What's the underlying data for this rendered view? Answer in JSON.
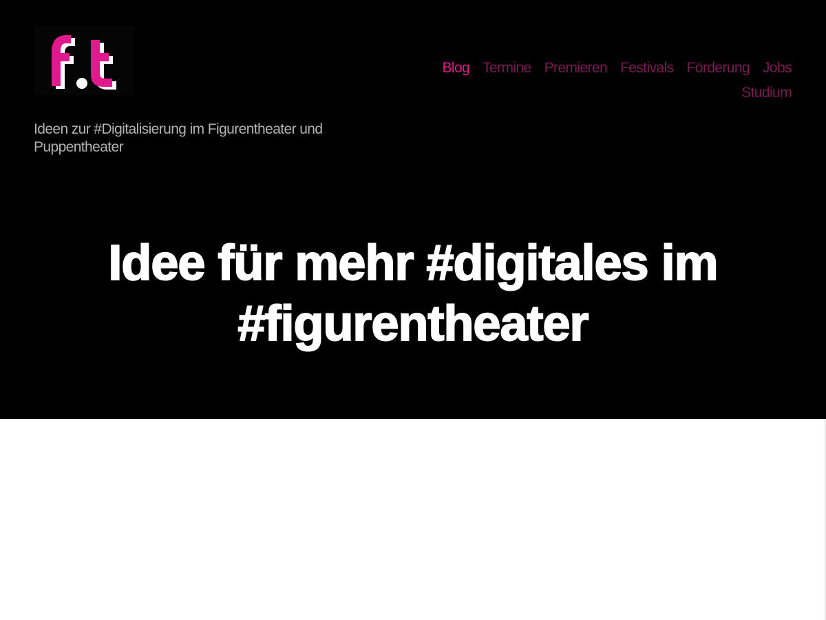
{
  "site": {
    "logo_text": "f.t",
    "tagline": "Ideen zur #Digitalisierung im Figurentheater und Puppentheater"
  },
  "nav": {
    "items": [
      {
        "label": "Blog",
        "active": true
      },
      {
        "label": "Termine",
        "active": false
      },
      {
        "label": "Premieren",
        "active": false
      },
      {
        "label": "Festivals",
        "active": false
      },
      {
        "label": "Förderung",
        "active": false
      },
      {
        "label": "Jobs",
        "active": false
      },
      {
        "label": "Studium",
        "active": false
      }
    ]
  },
  "page": {
    "title": "Idee für mehr #digitales im #figurentheater"
  },
  "colors": {
    "background": "#000000",
    "accent_active": "#e0198c",
    "nav_inactive": "#7a1a55",
    "tagline": "#b3b3b3",
    "title": "#ffffff"
  }
}
